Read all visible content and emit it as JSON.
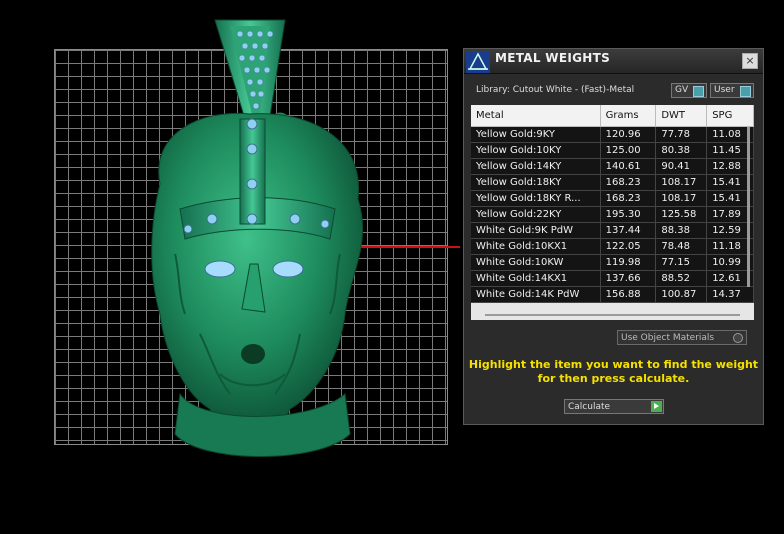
{
  "panel": {
    "title": "METAL WEIGHTS",
    "close_label": "×",
    "library_label": "Library: Cutout White - (Fast)-Metal",
    "gv_label": "GV",
    "user_label": "User",
    "table": {
      "headers": [
        "Metal",
        "Grams",
        "DWT",
        "SPG"
      ],
      "rows": [
        [
          "Yellow Gold:9KY",
          "120.96",
          "77.78",
          "11.08"
        ],
        [
          "Yellow Gold:10KY",
          "125.00",
          "80.38",
          "11.45"
        ],
        [
          "Yellow Gold:14KY",
          "140.61",
          "90.41",
          "12.88"
        ],
        [
          "Yellow Gold:18KY",
          "168.23",
          "108.17",
          "15.41"
        ],
        [
          "Yellow Gold:18KY R...",
          "168.23",
          "108.17",
          "15.41"
        ],
        [
          "Yellow Gold:22KY",
          "195.30",
          "125.58",
          "17.89"
        ],
        [
          "White Gold:9K PdW",
          "137.44",
          "88.38",
          "12.59"
        ],
        [
          "White Gold:10KX1",
          "122.05",
          "78.48",
          "11.18"
        ],
        [
          "White Gold:10KW",
          "119.98",
          "77.15",
          "10.99"
        ],
        [
          "White Gold:14KX1",
          "137.66",
          "88.52",
          "12.61"
        ],
        [
          "White Gold:14K PdW",
          "156.88",
          "100.87",
          "14.37"
        ]
      ]
    },
    "use_materials_label": "Use Object Materials",
    "hint_line1": "Highlight the item you want to find the weight",
    "hint_line2": "for then press calculate.",
    "calculate_label": "Calculate"
  },
  "colors": {
    "model_green": "#1f8a5e",
    "gem_blue": "#8fd0f0",
    "hint_yellow": "#f5e000",
    "axis_red": "#d01010"
  }
}
